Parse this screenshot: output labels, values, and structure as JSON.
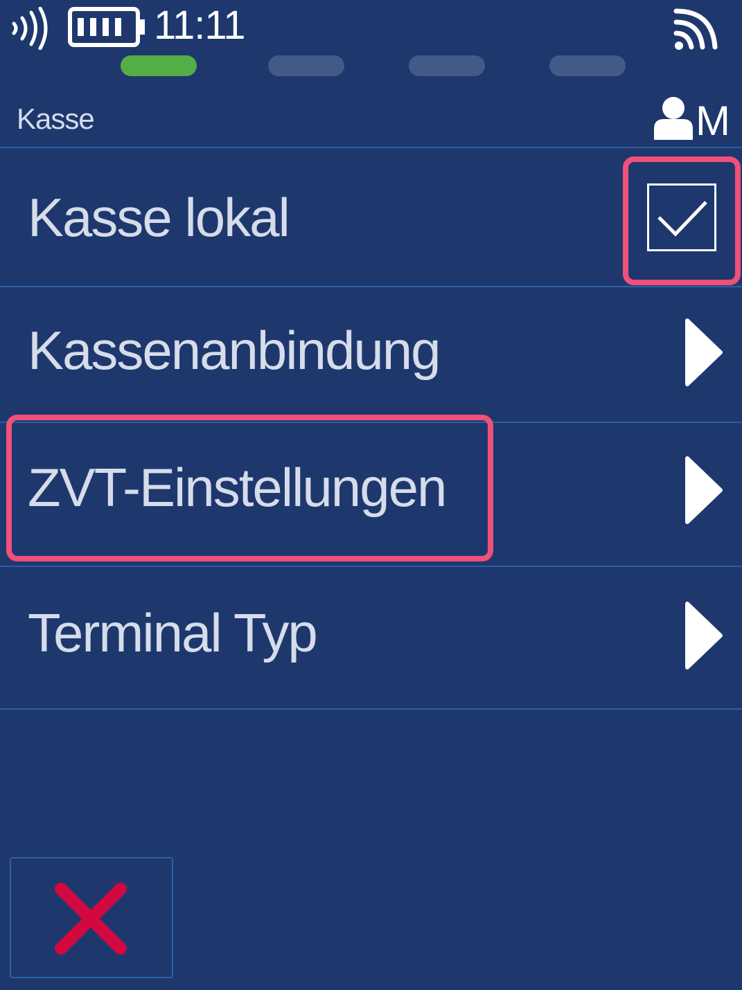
{
  "status_bar": {
    "time": "11:11",
    "icons": [
      "nfc-icon",
      "battery-icon",
      "wifi-icon"
    ]
  },
  "progress": {
    "steps": 4,
    "active_step": 1,
    "active_color": "#55ad46",
    "inactive_color": "#435a88"
  },
  "header": {
    "title": "Kasse",
    "user_letter": "M"
  },
  "menu": {
    "items": [
      {
        "label": "Kasse lokal",
        "control": "checkbox",
        "checked": true
      },
      {
        "label": "Kassenanbindung",
        "control": "chevron"
      },
      {
        "label": "ZVT-Einstellungen",
        "control": "chevron"
      },
      {
        "label": "Terminal Typ",
        "control": "chevron"
      }
    ]
  },
  "footer": {
    "cancel_icon": "close-icon"
  },
  "colors": {
    "background": "#1e386e",
    "divider": "#2f5ea3",
    "text": "#d6dcea",
    "highlight": "#f0507a",
    "cancel": "#d2083f"
  }
}
